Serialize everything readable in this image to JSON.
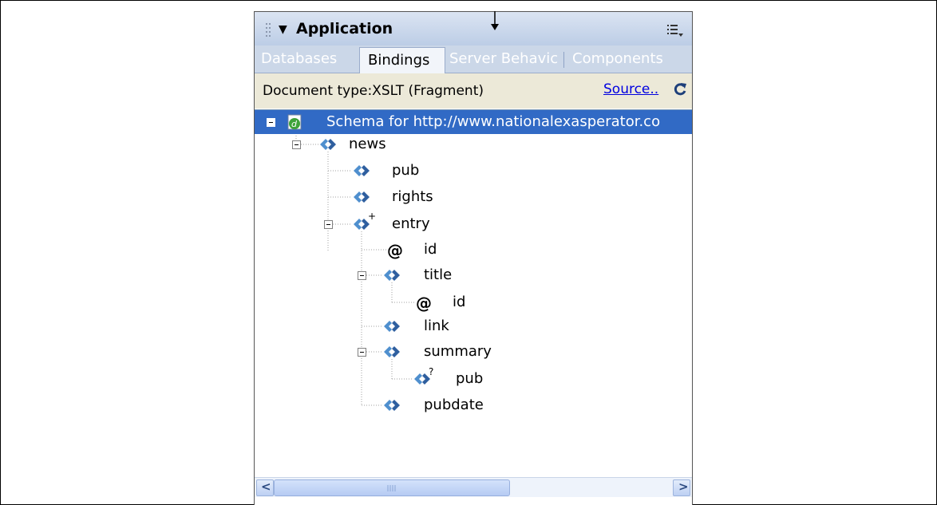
{
  "panel": {
    "title": "Application",
    "tabs": [
      {
        "label": "Databases",
        "active": false
      },
      {
        "label": "Bindings",
        "active": true
      },
      {
        "label": "Server Behavic",
        "active": false
      },
      {
        "label": "Components",
        "active": false
      }
    ],
    "document_type": "Document type:XSLT (Fragment)",
    "source_link": "Source..",
    "icons": [
      "expand-triangle-icon",
      "panel-options-icon",
      "refresh-icon",
      "schema-file-icon",
      "element-icon",
      "attribute-icon"
    ],
    "colors": {
      "selection": "#316ac5",
      "titlebar": "#bccde6",
      "tabs_bg": "#cbd7e8",
      "doc_row": "#ece9d8",
      "link": "#0000e0"
    }
  },
  "tree": {
    "root": "Schema for http://www.nationalexasperator.co",
    "nodes": [
      {
        "label": "news",
        "type": "element",
        "marker": ""
      },
      {
        "label": "pub",
        "type": "element",
        "marker": ""
      },
      {
        "label": "rights",
        "type": "element",
        "marker": ""
      },
      {
        "label": "entry",
        "type": "element",
        "marker": "+"
      },
      {
        "label": "id",
        "type": "attribute",
        "marker": ""
      },
      {
        "label": "title",
        "type": "element",
        "marker": ""
      },
      {
        "label": "id",
        "type": "attribute",
        "marker": ""
      },
      {
        "label": "link",
        "type": "element",
        "marker": ""
      },
      {
        "label": "summary",
        "type": "element",
        "marker": ""
      },
      {
        "label": "pub",
        "type": "element",
        "marker": "?"
      },
      {
        "label": "pubdate",
        "type": "element",
        "marker": ""
      }
    ]
  },
  "scrollbar": {
    "left_arrow": "<",
    "right_arrow": ">"
  }
}
